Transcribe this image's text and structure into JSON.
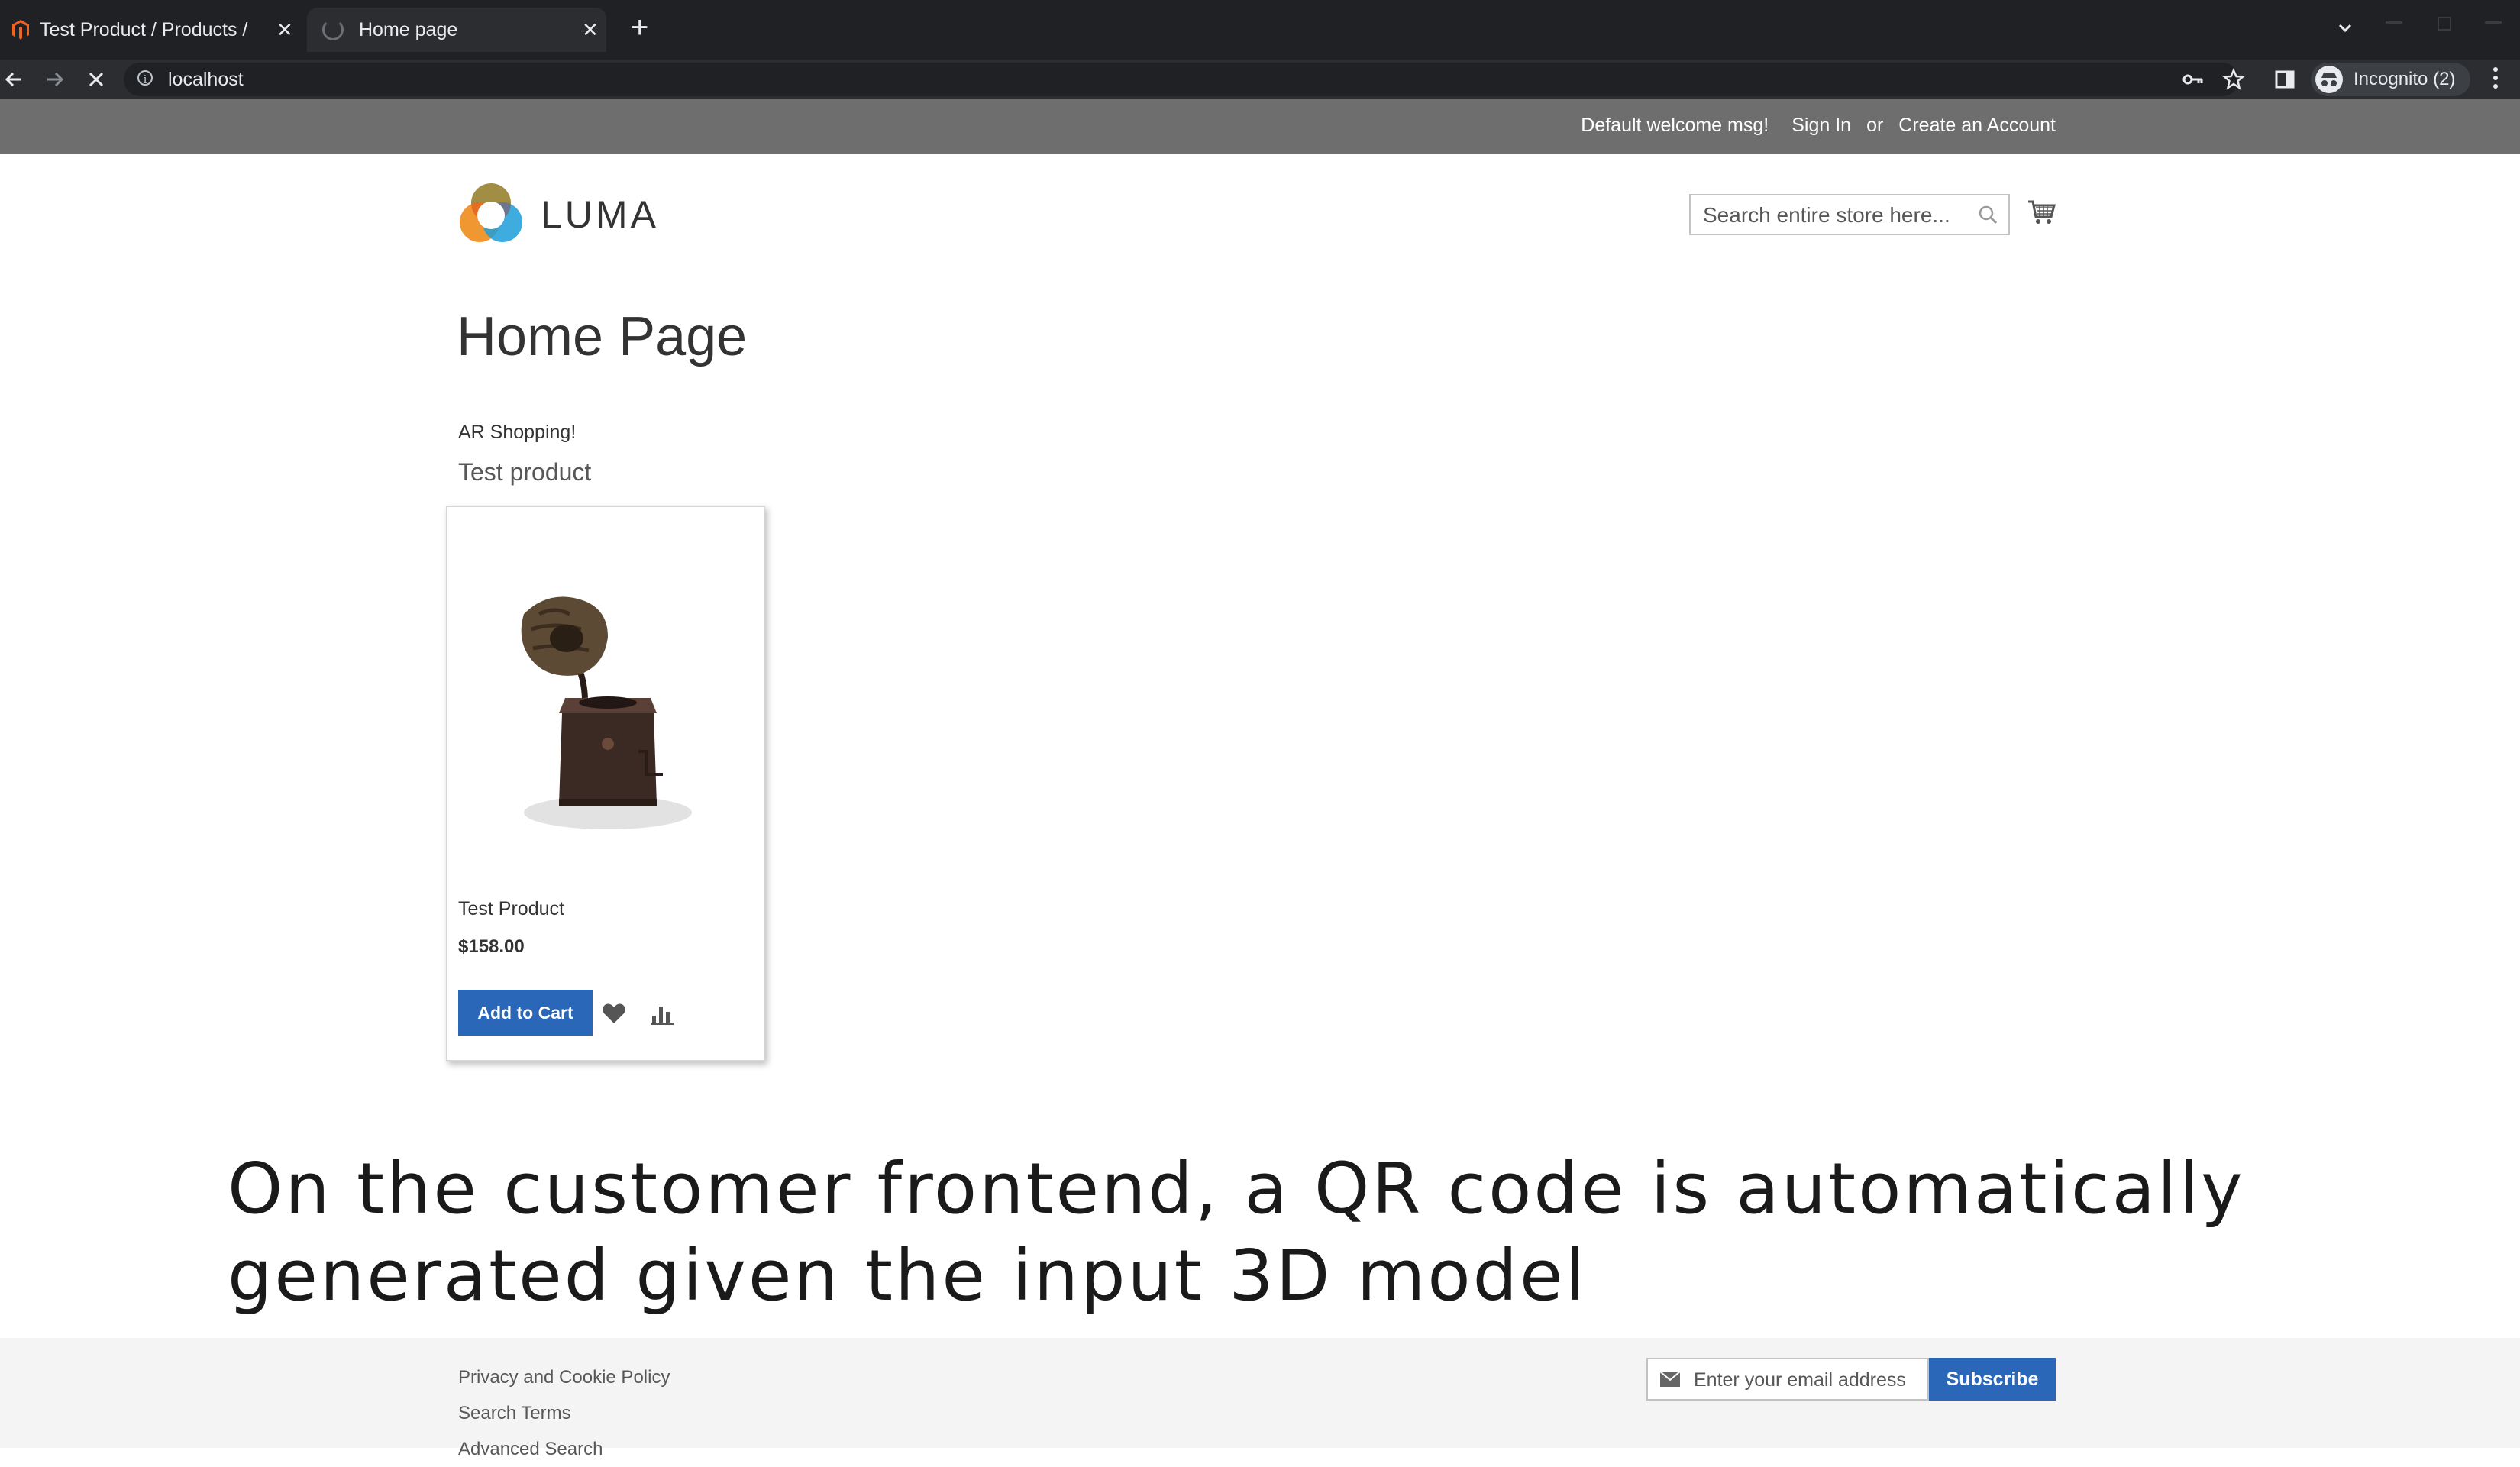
{
  "browser": {
    "tabs": [
      {
        "title": "Test Product / Products /",
        "active": false
      },
      {
        "title": "Home page",
        "active": true
      }
    ],
    "url": "localhost",
    "profile_label": "Incognito (2)"
  },
  "header": {
    "welcome": "Default welcome msg!",
    "sign_in": "Sign In",
    "or": "or",
    "create_account": "Create an Account",
    "logo_text": "LUMA",
    "search_placeholder": "Search entire store here..."
  },
  "main": {
    "page_title": "Home Page",
    "cms_text": "AR Shopping!",
    "block_title": "Test product",
    "product": {
      "name": "Test Product",
      "price": "$158.00",
      "add_to_cart": "Add to Cart"
    }
  },
  "caption": "On the customer frontend, a QR code is automatically generated given the input 3D model",
  "footer": {
    "links": [
      "Privacy and Cookie Policy",
      "Search Terms",
      "Advanced Search"
    ],
    "email_placeholder": "Enter your email address",
    "subscribe": "Subscribe"
  },
  "colors": {
    "accent_button": "#2a67b8",
    "top_panel": "#6e6e6e",
    "chrome_dark": "#1f2124"
  }
}
